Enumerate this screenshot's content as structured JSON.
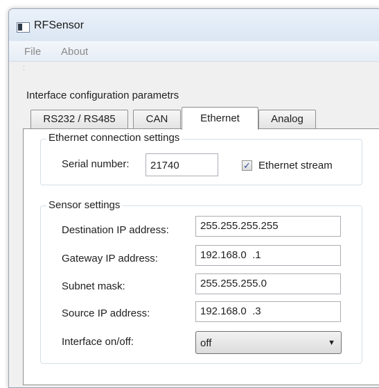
{
  "window": {
    "title": "RFSensor"
  },
  "menu": {
    "items": [
      "File",
      "About"
    ]
  },
  "interface": {
    "group_title": "Interface configuration parametrs",
    "tabs": [
      "RS232 / RS485",
      "CAN",
      "Ethernet",
      "Analog"
    ],
    "active_tab": "Ethernet"
  },
  "ethernet_connection": {
    "legend": "Ethernet connection settings",
    "serial_label": "Serial number:",
    "serial_value": "21740",
    "stream_label": "Ethernet stream",
    "stream_checked": true,
    "check_glyph": "✓"
  },
  "sensor_settings": {
    "legend": "Sensor settings",
    "fields": [
      {
        "label": "Destination IP address:",
        "value": "255.255.255.255"
      },
      {
        "label": "Gateway IP address:",
        "value": "192.168.0  .1"
      },
      {
        "label": "Subnet mask:",
        "value": "255.255.255.0"
      },
      {
        "label": "Source IP address:",
        "value": "192.168.0  .3"
      }
    ],
    "interface_label": "Interface on/off:",
    "interface_value": "off",
    "dropdown_icon": "▼"
  },
  "icons": {
    "app": "app-window-icon",
    "dropdown": "chevron-down-icon"
  }
}
